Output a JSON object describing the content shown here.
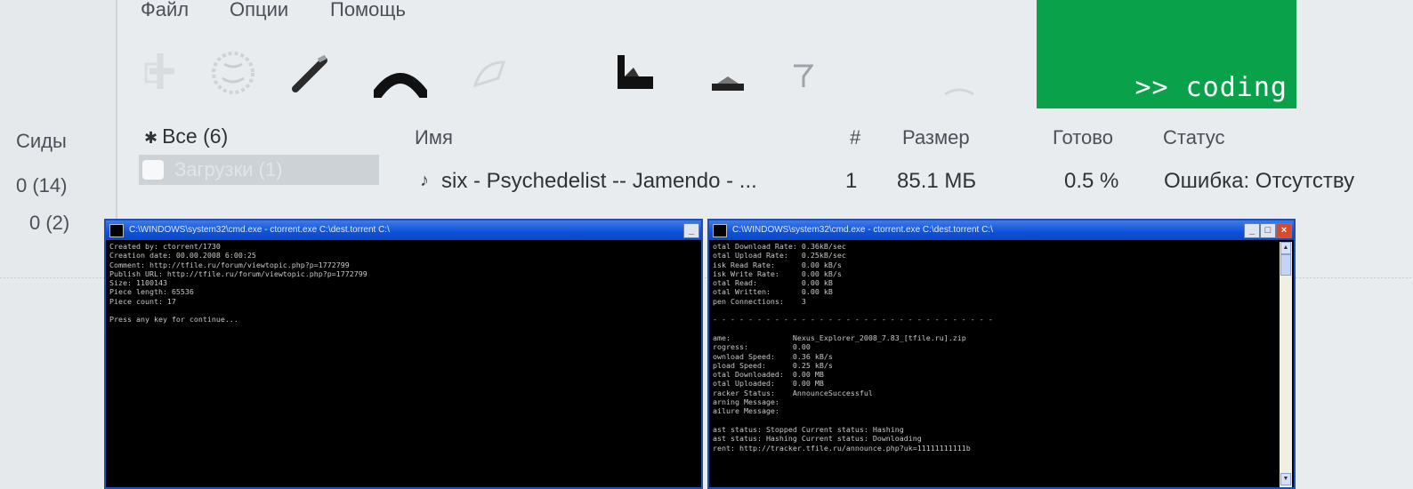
{
  "menu": {
    "file": "Файл",
    "options": "Опции",
    "help": "Помощь"
  },
  "toolbar": {
    "icons": [
      "add-torrent-icon",
      "web-icon",
      "edit-icon",
      "remote-icon",
      "rss-icon",
      "priority-icon",
      "minimize-icon",
      "filter-icon"
    ]
  },
  "badge": {
    "text": ">> coding",
    "color": "#0aa14b"
  },
  "left_panel": {
    "header": "Сиды",
    "values": [
      "0 (14)",
      "0 (2)"
    ]
  },
  "filter": {
    "all": "Все (6)",
    "second": "Загрузки (1)"
  },
  "columns": {
    "name": "Имя",
    "num": "#",
    "size": "Размер",
    "done": "Готово",
    "status": "Статус"
  },
  "row": {
    "name": "six - Psychedelist -- Jamendo - ...",
    "num": "1",
    "size": "85.1 МБ",
    "done": "0.5 %",
    "status": "Ошибка: Отсутству"
  },
  "cmd1": {
    "title": "C:\\WINDOWS\\system32\\cmd.exe - ctorrent.exe C:\\dest.torrent C:\\",
    "lines": [
      "Created by: ctorrent/1730",
      "Creation date: 00.00.2008 6:00:25",
      "Comment: http://tfile.ru/forum/viewtopic.php?p=1772799",
      "Publish URL: http://tfile.ru/forum/viewtopic.php?p=1772799",
      "Size: 1100143",
      "Piece length: 65536",
      "Piece count: 17",
      "",
      "Press any key for continue..."
    ]
  },
  "cmd2": {
    "title": "C:\\WINDOWS\\system32\\cmd.exe - ctorrent.exe C:\\dest.torrent C:\\",
    "lines": [
      "otal Download Rate: 0.36kB/sec",
      "otal Upload Rate:   0.25kB/sec",
      "isk Read Rate:      0.00 kB/s",
      "isk Write Rate:     0.00 kB/s",
      "otal Read:          0.00 kB",
      "otal Written:       0.00 kB",
      "pen Connections:    3",
      "",
      "- - - - - - - - - - - - - - - - - - - - - - - - - - - - - - - -",
      "",
      "ame:              Nexus_Explorer_2008_7.83_[tfile.ru].zip",
      "rogress:          0.00",
      "ownload Speed:    0.36 kB/s",
      "pload Speed:      0.25 kB/s",
      "otal Downloaded:  0.00 MB",
      "otal Uploaded:    0.00 MB",
      "racker Status:    AnnounceSuccessful",
      "arning Message:",
      "ailure Message:",
      "",
      "ast status: Stopped Current status: Hashing",
      "ast status: Hashing Current status: Downloading",
      "rent: http://tracker.tfile.ru/announce.php?uk=11111111111b"
    ]
  }
}
